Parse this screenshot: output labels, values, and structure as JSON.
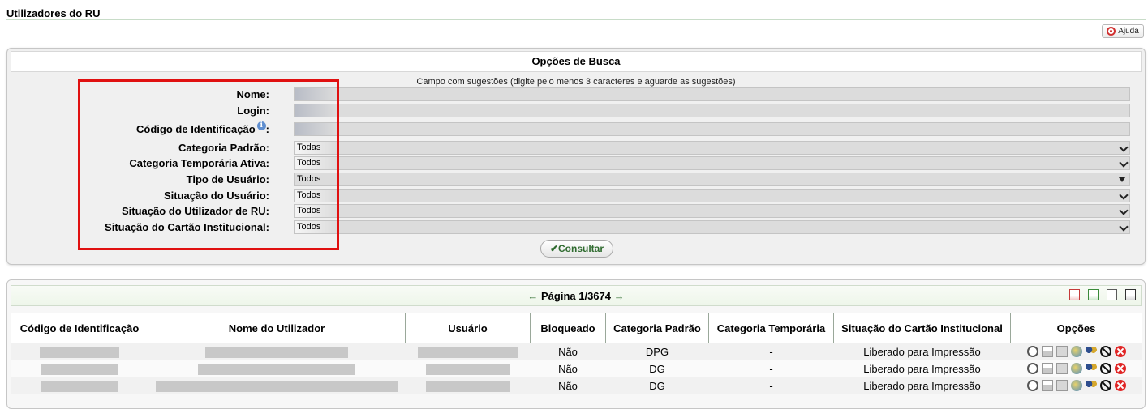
{
  "page": {
    "title": "Utilizadores do RU",
    "help_label": "Ajuda"
  },
  "search": {
    "header": "Opções de Busca",
    "hint": "Campo com sugestões (digite pelo menos 3 caracteres e aguarde as sugestões)",
    "fields": {
      "nome": {
        "label": "Nome:",
        "value": ""
      },
      "login": {
        "label": "Login:",
        "value": ""
      },
      "codigo": {
        "label": "Código de Identificação",
        "suffix": ":",
        "value": ""
      },
      "categoria_padrao": {
        "label": "Categoria Padrão:",
        "value": "Todas"
      },
      "categoria_temporaria": {
        "label": "Categoria Temporária Ativa:",
        "value": "Todos"
      },
      "tipo_usuario": {
        "label": "Tipo de Usuário:",
        "value": "Todos"
      },
      "situacao_usuario": {
        "label": "Situação do Usuário:",
        "value": "Todos"
      },
      "situacao_utilizador": {
        "label": "Situação do Utilizador de RU:",
        "value": "Todos"
      },
      "situacao_cartao": {
        "label": "Situação do Cartão Institucional:",
        "value": "Todos"
      }
    },
    "info_icon_glyph": "i",
    "submit_check": "✔",
    "submit_label": "Consultar"
  },
  "results": {
    "pager": {
      "prev_arrow": "←",
      "label": "Página 1/3674",
      "next_arrow": "→"
    },
    "export_icons": [
      "pdf-icon",
      "xls-icon",
      "rtf-icon",
      "doc-icon"
    ],
    "columns": {
      "codigo": "Código de Identificação",
      "nome": "Nome do Utilizador",
      "usuario": "Usuário",
      "bloqueado": "Bloqueado",
      "cat_padrao": "Categoria Padrão",
      "cat_temporaria": "Categoria Temporária",
      "situacao_cartao": "Situação do Cartão Institucional",
      "opcoes": "Opções"
    },
    "rows": [
      {
        "codigo": "",
        "nome": "",
        "usuario": "",
        "bloqueado": "Não",
        "cat_padrao": "DPG",
        "cat_temporaria": "-",
        "situacao_cartao": "Liberado para Impressão"
      },
      {
        "codigo": "",
        "nome": "",
        "usuario": "",
        "bloqueado": "Não",
        "cat_padrao": "DG",
        "cat_temporaria": "-",
        "situacao_cartao": "Liberado para Impressão"
      },
      {
        "codigo": "",
        "nome": "",
        "usuario": "",
        "bloqueado": "Não",
        "cat_padrao": "DG",
        "cat_temporaria": "-",
        "situacao_cartao": "Liberado para Impressão"
      }
    ],
    "row_action_icons": [
      "binoculars-icon",
      "cart-icon",
      "calculator-icon",
      "globe-icon",
      "users-icon",
      "block-icon",
      "delete-icon"
    ]
  },
  "colors": {
    "highlight_border": "#e01010",
    "accent_green": "#2f6b2f",
    "row_divider": "#4e8c4e"
  }
}
